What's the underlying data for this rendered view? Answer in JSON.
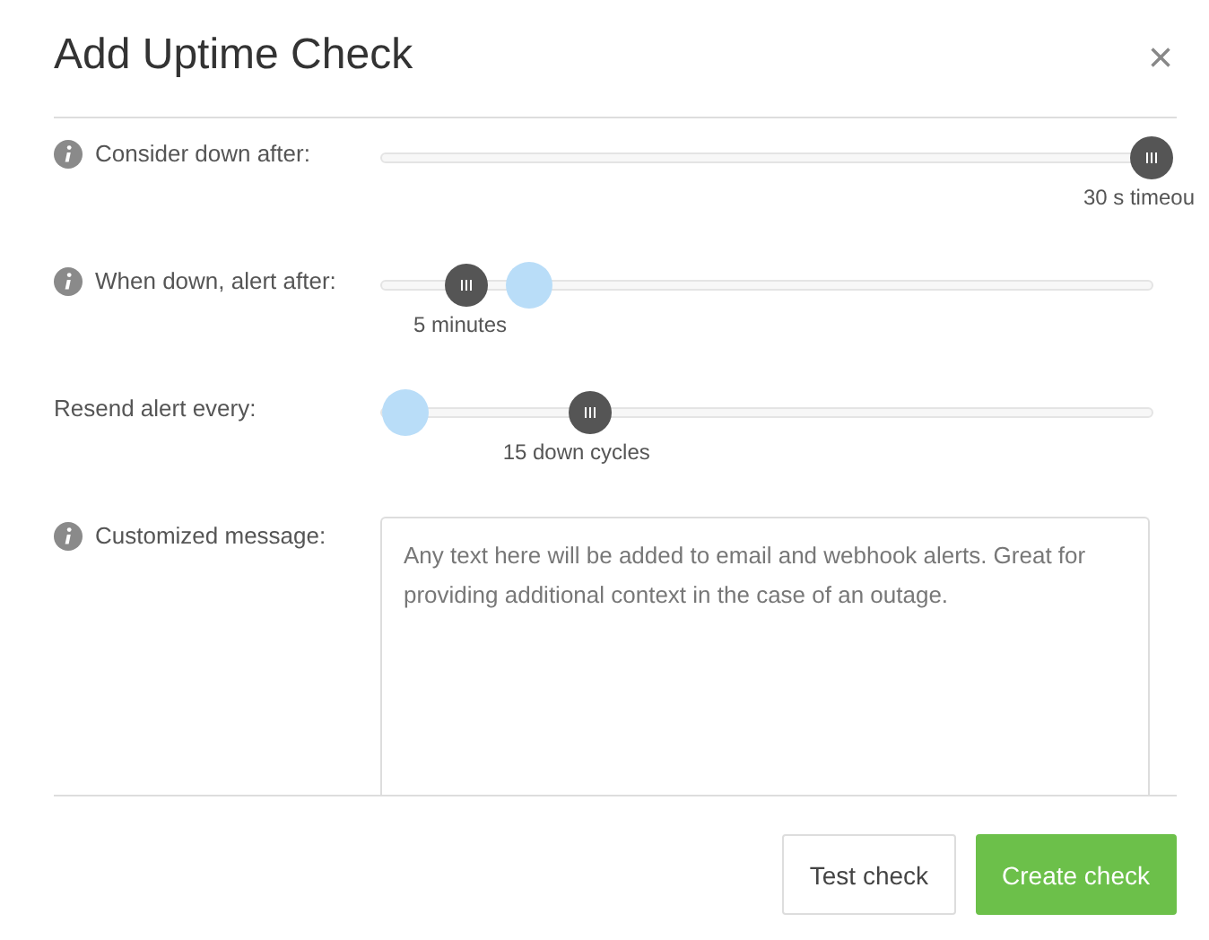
{
  "dialog": {
    "title": "Add Uptime Check",
    "close": "×"
  },
  "sliders": [
    {
      "label": "Consider down after:",
      "info": true,
      "handles": [
        {
          "kind": "grip",
          "level": 1.0
        }
      ],
      "reading": "30 s timeou"
    },
    {
      "label": "When down, alert after:",
      "info": true,
      "handles": [
        {
          "kind": "grip",
          "level": 0.11
        },
        {
          "kind": "focus",
          "level": 0.19
        }
      ],
      "reading": "5 minutes"
    },
    {
      "label": "Resend alert every:",
      "info": false,
      "handles": [
        {
          "kind": "focus",
          "level": 0.03
        },
        {
          "kind": "grip",
          "level": 0.27
        }
      ],
      "reading": "15 down cycles"
    }
  ],
  "message": {
    "label": "Customized message:",
    "info": true,
    "placeholder": "Any text here will be added to email and webhook alerts. Great for providing additional context in the case of an outage."
  },
  "buttons": [
    {
      "label": "Test check",
      "kind": "secondary"
    },
    {
      "label": "Create check",
      "kind": "primary"
    }
  ]
}
